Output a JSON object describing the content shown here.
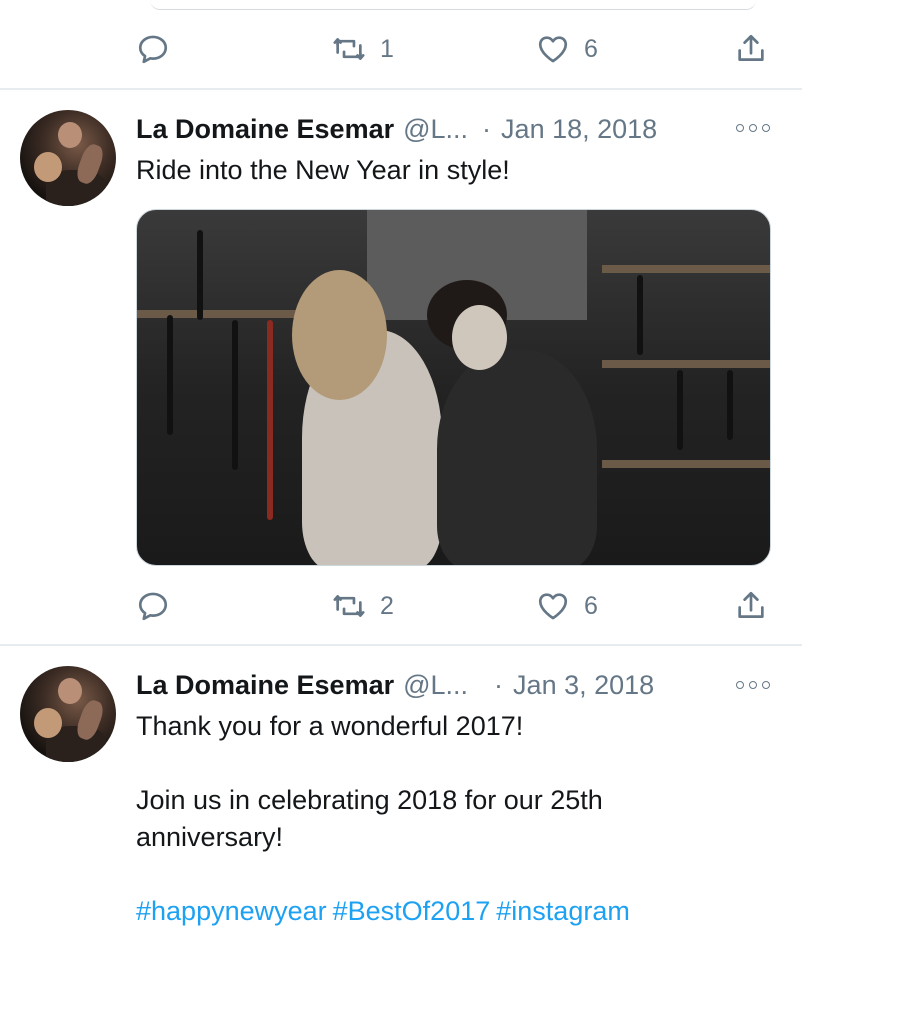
{
  "previous_tweet": {
    "actions": {
      "reply_count": "",
      "retweet_count": "1",
      "like_count": "6"
    }
  },
  "tweets": [
    {
      "author_name": "La Domaine Esemar",
      "handle": "@L...",
      "separator": "·",
      "date": "Jan 18, 2018",
      "text_lines": [
        "Ride into the New Year in style!"
      ],
      "media": "photo",
      "actions": {
        "reply_count": "",
        "retweet_count": "2",
        "like_count": "6"
      }
    },
    {
      "author_name": "La Domaine Esemar",
      "handle": "@L...",
      "separator": "·",
      "date": "Jan 3, 2018",
      "text_lines": [
        "Thank you for a wonderful 2017!",
        "",
        "Join us in celebrating 2018 for our 25th",
        "anniversary!",
        ""
      ],
      "hashtags": [
        "#happynewyear",
        "#BestOf2017",
        "#instagram"
      ]
    }
  ],
  "icons": {
    "reply": "reply-icon",
    "retweet": "retweet-icon",
    "like": "heart-icon",
    "share": "share-icon",
    "more": "more-options-icon"
  },
  "colors": {
    "text": "#14171a",
    "secondary": "#657786",
    "link": "#1da1f2",
    "divider": "#e6ecf0"
  }
}
